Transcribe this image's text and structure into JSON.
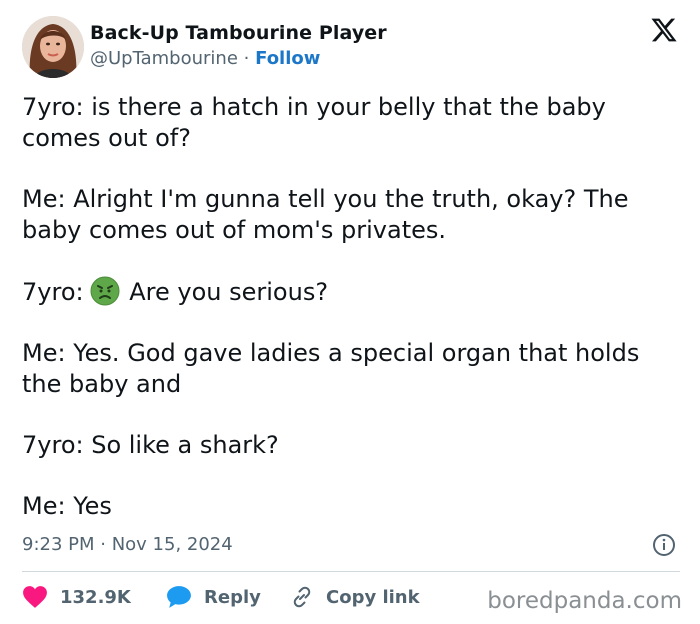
{
  "author": {
    "display_name": "Back-Up Tambourine Player",
    "handle": "@UpTambourine",
    "separator": "·",
    "follow_label": "Follow"
  },
  "post": {
    "paragraphs": [
      "7yro: is there a hatch in your belly that the baby comes out of?",
      "Me: Alright I'm gunna tell you the truth, okay? The baby comes out of mom's privates.",
      "Me: Yes. God gave ladies a special organ that holds the baby and",
      "7yro: So like a shark?",
      "Me: Yes"
    ],
    "emoji_line": {
      "prefix": "7yro:",
      "emoji": "nauseated-face",
      "suffix": "Are you serious?"
    },
    "timestamp": "9:23 PM · Nov 15, 2024"
  },
  "actions": {
    "likes_count": "132.9K",
    "reply_label": "Reply",
    "copy_link_label": "Copy link"
  },
  "watermark": "boredpanda.com",
  "colors": {
    "like": "#f91880",
    "reply": "#1d9bf0",
    "follow": "#1d77c9",
    "muted": "#536471"
  }
}
